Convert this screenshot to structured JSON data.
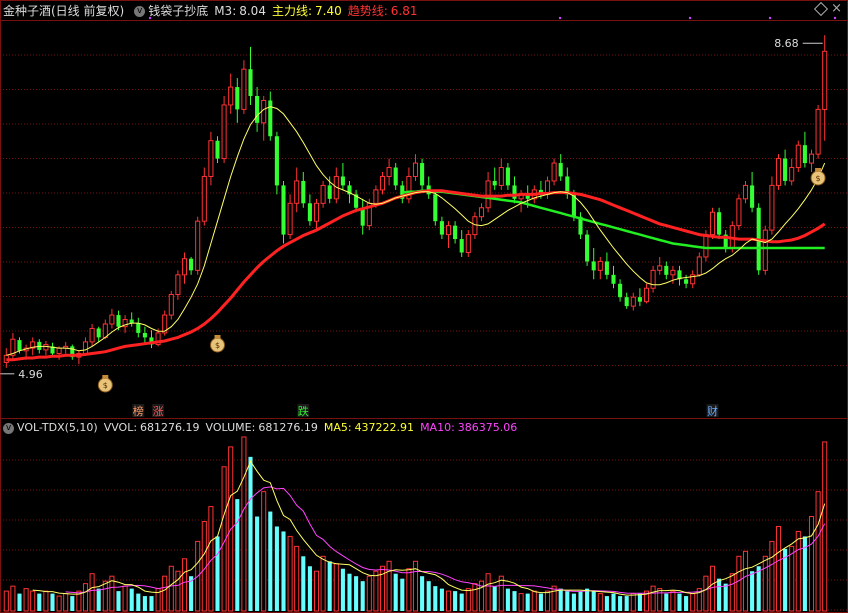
{
  "header": {
    "stock": "金种子酒(日线 前复权)",
    "indicator": "钱袋子抄底",
    "m3_label": "M3:",
    "m3_value": "8.04",
    "main_label": "主力线:",
    "main_value": "7.40",
    "trend_label": "趋势线:",
    "trend_value": "6.81"
  },
  "price_panel": {
    "high_label": "8.68",
    "low_label": "4.96",
    "ylim": [
      4.6,
      8.85
    ]
  },
  "markers": [
    {
      "text": "榜",
      "color": "#ff9966"
    },
    {
      "text": "涨",
      "color": "#ff5555"
    },
    {
      "text": "跌",
      "color": "#33ee33"
    },
    {
      "text": "财",
      "color": "#66aaff"
    }
  ],
  "volume_header": {
    "name": "VOL-TDX(5,10)",
    "vvol_label": "VVOL:",
    "vvol_value": "681276.19",
    "volume_label": "VOLUME:",
    "volume_value": "681276.19",
    "ma5_label": "MA5:",
    "ma5_value": "437222.91",
    "ma10_label": "MA10:",
    "ma10_value": "386375.06"
  },
  "colors": {
    "up": "#ff3333",
    "down": "#33ff33",
    "vol_down": "#66ffff",
    "m3": "#ffff66",
    "main": "#ff2222",
    "trend": "#22ee22",
    "ma5": "#ffff66",
    "ma10": "#ff44ff",
    "grid": "#7a1010"
  },
  "chart_data": {
    "type": "candlestick",
    "ylim": [
      4.6,
      8.85
    ],
    "candles": [
      [
        5.02,
        5.18,
        4.96,
        5.1
      ],
      [
        5.1,
        5.35,
        5.05,
        5.28
      ],
      [
        5.27,
        5.3,
        5.12,
        5.15
      ],
      [
        5.15,
        5.22,
        5.05,
        5.18
      ],
      [
        5.18,
        5.3,
        5.1,
        5.25
      ],
      [
        5.25,
        5.28,
        5.12,
        5.16
      ],
      [
        5.16,
        5.26,
        5.1,
        5.22
      ],
      [
        5.2,
        5.24,
        5.08,
        5.12
      ],
      [
        5.12,
        5.2,
        5.05,
        5.18
      ],
      [
        5.18,
        5.25,
        5.12,
        5.2
      ],
      [
        5.2,
        5.22,
        5.05,
        5.08
      ],
      [
        5.08,
        5.15,
        5.0,
        5.12
      ],
      [
        5.12,
        5.3,
        5.1,
        5.25
      ],
      [
        5.25,
        5.45,
        5.2,
        5.4
      ],
      [
        5.4,
        5.42,
        5.25,
        5.3
      ],
      [
        5.3,
        5.5,
        5.28,
        5.45
      ],
      [
        5.45,
        5.62,
        5.4,
        5.55
      ],
      [
        5.55,
        5.6,
        5.38,
        5.42
      ],
      [
        5.42,
        5.55,
        5.35,
        5.5
      ],
      [
        5.5,
        5.58,
        5.42,
        5.46
      ],
      [
        5.46,
        5.52,
        5.3,
        5.35
      ],
      [
        5.35,
        5.42,
        5.22,
        5.3
      ],
      [
        5.3,
        5.38,
        5.18,
        5.22
      ],
      [
        5.22,
        5.4,
        5.2,
        5.35
      ],
      [
        5.35,
        5.6,
        5.32,
        5.55
      ],
      [
        5.55,
        5.82,
        5.5,
        5.78
      ],
      [
        5.78,
        6.05,
        5.72,
        6.0
      ],
      [
        6.0,
        6.25,
        5.9,
        6.18
      ],
      [
        6.18,
        6.2,
        6.0,
        6.05
      ],
      [
        6.05,
        6.65,
        6.0,
        6.6
      ],
      [
        6.6,
        7.2,
        6.55,
        7.1
      ],
      [
        7.1,
        7.6,
        7.0,
        7.5
      ],
      [
        7.5,
        7.55,
        7.25,
        7.3
      ],
      [
        7.3,
        8.0,
        7.25,
        7.9
      ],
      [
        7.9,
        8.25,
        7.8,
        8.1
      ],
      [
        8.1,
        8.2,
        7.7,
        7.85
      ],
      [
        7.85,
        8.4,
        7.8,
        8.3
      ],
      [
        8.3,
        8.55,
        7.9,
        8.0
      ],
      [
        8.0,
        8.1,
        7.6,
        7.7
      ],
      [
        7.7,
        8.0,
        7.5,
        7.95
      ],
      [
        7.95,
        8.05,
        7.5,
        7.55
      ],
      [
        7.55,
        7.6,
        6.9,
        7.0
      ],
      [
        7.0,
        7.05,
        6.35,
        6.45
      ],
      [
        6.45,
        6.9,
        6.4,
        6.8
      ],
      [
        6.8,
        7.2,
        6.7,
        7.05
      ],
      [
        7.05,
        7.15,
        6.75,
        6.8
      ],
      [
        6.8,
        6.9,
        6.55,
        6.6
      ],
      [
        6.6,
        6.85,
        6.5,
        6.8
      ],
      [
        6.8,
        7.05,
        6.75,
        7.0
      ],
      [
        7.0,
        7.1,
        6.8,
        6.85
      ],
      [
        6.85,
        7.2,
        6.8,
        7.1
      ],
      [
        7.1,
        7.25,
        6.95,
        7.0
      ],
      [
        7.0,
        7.05,
        6.8,
        6.9
      ],
      [
        6.9,
        6.95,
        6.7,
        6.75
      ],
      [
        6.75,
        6.85,
        6.45,
        6.55
      ],
      [
        6.55,
        6.85,
        6.5,
        6.8
      ],
      [
        6.8,
        7.0,
        6.75,
        6.95
      ],
      [
        6.95,
        7.15,
        6.9,
        7.1
      ],
      [
        7.1,
        7.3,
        7.0,
        7.2
      ],
      [
        7.2,
        7.25,
        6.95,
        7.0
      ],
      [
        7.0,
        7.05,
        6.8,
        6.85
      ],
      [
        6.85,
        7.2,
        6.8,
        7.1
      ],
      [
        7.1,
        7.35,
        7.05,
        7.25
      ],
      [
        7.25,
        7.3,
        6.95,
        7.0
      ],
      [
        7.0,
        7.1,
        6.85,
        6.9
      ],
      [
        6.9,
        6.95,
        6.55,
        6.6
      ],
      [
        6.6,
        6.65,
        6.4,
        6.45
      ],
      [
        6.45,
        6.6,
        6.3,
        6.55
      ],
      [
        6.55,
        6.6,
        6.35,
        6.4
      ],
      [
        6.4,
        6.5,
        6.2,
        6.25
      ],
      [
        6.25,
        6.5,
        6.2,
        6.45
      ],
      [
        6.45,
        6.7,
        6.4,
        6.65
      ],
      [
        6.65,
        6.8,
        6.6,
        6.75
      ],
      [
        6.75,
        7.15,
        6.7,
        7.05
      ],
      [
        7.05,
        7.2,
        6.95,
        7.0
      ],
      [
        7.0,
        7.3,
        6.95,
        7.2
      ],
      [
        7.2,
        7.25,
        6.95,
        7.0
      ],
      [
        7.0,
        7.1,
        6.8,
        6.85
      ],
      [
        6.85,
        6.95,
        6.7,
        6.9
      ],
      [
        6.9,
        7.0,
        6.75,
        6.85
      ],
      [
        6.85,
        7.0,
        6.8,
        6.95
      ],
      [
        6.95,
        7.05,
        6.85,
        6.9
      ],
      [
        6.9,
        7.1,
        6.85,
        7.05
      ],
      [
        7.05,
        7.3,
        7.0,
        7.25
      ],
      [
        7.25,
        7.35,
        7.05,
        7.1
      ],
      [
        7.1,
        7.2,
        6.85,
        6.9
      ],
      [
        6.9,
        6.95,
        6.6,
        6.65
      ],
      [
        6.65,
        6.7,
        6.4,
        6.45
      ],
      [
        6.45,
        6.5,
        6.1,
        6.15
      ],
      [
        6.15,
        6.3,
        5.95,
        6.05
      ],
      [
        6.05,
        6.2,
        5.95,
        6.15
      ],
      [
        6.15,
        6.25,
        5.95,
        6.0
      ],
      [
        6.0,
        6.1,
        5.85,
        5.9
      ],
      [
        5.9,
        5.95,
        5.7,
        5.75
      ],
      [
        5.75,
        5.8,
        5.62,
        5.65
      ],
      [
        5.65,
        5.8,
        5.6,
        5.75
      ],
      [
        5.75,
        5.85,
        5.65,
        5.7
      ],
      [
        5.7,
        5.9,
        5.68,
        5.85
      ],
      [
        5.85,
        6.1,
        5.8,
        6.05
      ],
      [
        6.05,
        6.2,
        6.0,
        6.1
      ],
      [
        6.1,
        6.15,
        5.95,
        6.0
      ],
      [
        6.0,
        6.1,
        5.9,
        6.05
      ],
      [
        6.05,
        6.1,
        5.88,
        5.95
      ],
      [
        5.95,
        6.0,
        5.85,
        5.9
      ],
      [
        5.9,
        6.05,
        5.85,
        6.0
      ],
      [
        6.0,
        6.25,
        5.98,
        6.2
      ],
      [
        6.2,
        6.5,
        6.15,
        6.45
      ],
      [
        6.45,
        6.75,
        6.4,
        6.7
      ],
      [
        6.7,
        6.75,
        6.4,
        6.45
      ],
      [
        6.45,
        6.5,
        6.25,
        6.3
      ],
      [
        6.3,
        6.6,
        6.25,
        6.55
      ],
      [
        6.55,
        6.9,
        6.5,
        6.85
      ],
      [
        6.85,
        7.05,
        6.8,
        7.0
      ],
      [
        7.0,
        7.15,
        6.7,
        6.75
      ],
      [
        6.75,
        6.8,
        6.0,
        6.05
      ],
      [
        6.05,
        6.55,
        6.0,
        6.5
      ],
      [
        6.5,
        7.1,
        6.45,
        7.0
      ],
      [
        7.0,
        7.35,
        6.95,
        7.3
      ],
      [
        7.3,
        7.4,
        7.0,
        7.05
      ],
      [
        7.05,
        7.3,
        7.0,
        7.2
      ],
      [
        7.2,
        7.5,
        7.15,
        7.45
      ],
      [
        7.45,
        7.6,
        7.2,
        7.25
      ],
      [
        7.25,
        7.4,
        7.15,
        7.35
      ],
      [
        7.35,
        7.9,
        7.3,
        7.85
      ],
      [
        7.85,
        8.68,
        7.5,
        8.5
      ]
    ],
    "m3": [
      5.1,
      5.12,
      5.15,
      5.17,
      5.19,
      5.2,
      5.2,
      5.19,
      5.18,
      5.18,
      5.17,
      5.15,
      5.16,
      5.2,
      5.25,
      5.3,
      5.36,
      5.41,
      5.44,
      5.46,
      5.46,
      5.44,
      5.4,
      5.37,
      5.37,
      5.42,
      5.5,
      5.62,
      5.75,
      5.9,
      6.1,
      6.35,
      6.6,
      6.85,
      7.1,
      7.32,
      7.52,
      7.68,
      7.78,
      7.85,
      7.88,
      7.86,
      7.8,
      7.7,
      7.6,
      7.48,
      7.35,
      7.22,
      7.12,
      7.04,
      6.98,
      6.95,
      6.92,
      6.88,
      6.84,
      6.8,
      6.79,
      6.8,
      6.83,
      6.86,
      6.88,
      6.9,
      6.92,
      6.93,
      6.93,
      6.91,
      6.86,
      6.8,
      6.74,
      6.67,
      6.6,
      6.56,
      6.55,
      6.57,
      6.62,
      6.67,
      6.72,
      6.76,
      6.8,
      6.83,
      6.86,
      6.88,
      6.9,
      6.92,
      6.93,
      6.92,
      6.88,
      6.81,
      6.72,
      6.61,
      6.5,
      6.4,
      6.3,
      6.21,
      6.12,
      6.04,
      5.97,
      5.91,
      5.89,
      5.89,
      5.91,
      5.94,
      5.96,
      5.97,
      5.98,
      5.99,
      6.02,
      6.07,
      6.13,
      6.18,
      6.22,
      6.28,
      6.35,
      6.4,
      6.38,
      6.36,
      6.4,
      6.48,
      6.57,
      6.65,
      6.74,
      6.84,
      6.95,
      7.08,
      7.25
    ],
    "main": [
      5.05,
      5.05,
      5.06,
      5.07,
      5.07,
      5.08,
      5.08,
      5.09,
      5.09,
      5.1,
      5.1,
      5.1,
      5.11,
      5.12,
      5.13,
      5.14,
      5.16,
      5.18,
      5.2,
      5.21,
      5.22,
      5.23,
      5.24,
      5.25,
      5.26,
      5.28,
      5.3,
      5.33,
      5.36,
      5.4,
      5.45,
      5.51,
      5.58,
      5.66,
      5.74,
      5.83,
      5.92,
      6.0,
      6.08,
      6.15,
      6.21,
      6.27,
      6.32,
      6.36,
      6.4,
      6.44,
      6.47,
      6.5,
      6.54,
      6.58,
      6.62,
      6.66,
      6.69,
      6.72,
      6.74,
      6.76,
      6.78,
      6.8,
      6.83,
      6.86,
      6.88,
      6.9,
      6.92,
      6.93,
      6.94,
      6.94,
      6.94,
      6.93,
      6.92,
      6.91,
      6.9,
      6.89,
      6.88,
      6.88,
      6.88,
      6.88,
      6.89,
      6.89,
      6.9,
      6.9,
      6.9,
      6.91,
      6.91,
      6.92,
      6.92,
      6.92,
      6.91,
      6.9,
      6.88,
      6.86,
      6.84,
      6.81,
      6.78,
      6.75,
      6.72,
      6.69,
      6.66,
      6.63,
      6.6,
      6.57,
      6.55,
      6.53,
      6.51,
      6.49,
      6.47,
      6.45,
      6.44,
      6.43,
      6.42,
      6.42,
      6.41,
      6.4,
      6.4,
      6.4,
      6.39,
      6.38,
      6.37,
      6.37,
      6.38,
      6.39,
      6.41,
      6.44,
      6.48,
      6.52,
      6.57
    ],
    "trend": [
      null,
      null,
      null,
      null,
      null,
      null,
      null,
      null,
      null,
      null,
      null,
      null,
      null,
      null,
      null,
      null,
      null,
      null,
      null,
      null,
      null,
      null,
      null,
      null,
      null,
      null,
      null,
      null,
      null,
      null,
      null,
      null,
      null,
      null,
      null,
      null,
      null,
      null,
      null,
      null,
      null,
      null,
      null,
      null,
      null,
      null,
      null,
      null,
      null,
      null,
      null,
      null,
      null,
      null,
      null,
      null,
      null,
      null,
      null,
      null,
      6.92,
      6.93,
      6.93,
      6.94,
      6.94,
      6.93,
      6.93,
      6.92,
      6.91,
      6.9,
      6.89,
      6.88,
      6.87,
      6.86,
      6.85,
      6.84,
      6.83,
      6.82,
      6.81,
      6.79,
      6.77,
      6.75,
      6.73,
      6.71,
      6.69,
      6.67,
      6.65,
      6.63,
      6.61,
      6.59,
      6.57,
      6.55,
      6.53,
      6.51,
      6.49,
      6.47,
      6.45,
      6.43,
      6.41,
      6.39,
      6.37,
      6.35,
      6.34,
      6.33,
      6.32,
      6.31,
      6.3,
      6.3,
      6.3,
      6.3,
      6.3,
      6.3,
      6.3,
      6.3,
      6.3,
      6.3,
      6.3,
      6.3,
      6.3,
      6.3,
      6.3,
      6.3,
      6.3,
      6.3,
      6.3
    ],
    "volume": [
      8,
      10,
      7,
      9,
      8,
      7,
      8,
      7,
      6,
      7,
      6,
      8,
      11,
      15,
      9,
      12,
      14,
      8,
      10,
      9,
      7,
      6,
      6,
      9,
      14,
      18,
      16,
      21,
      14,
      28,
      36,
      42,
      30,
      58,
      66,
      45,
      70,
      62,
      38,
      48,
      40,
      34,
      32,
      30,
      26,
      22,
      18,
      16,
      22,
      20,
      19,
      17,
      15,
      14,
      12,
      14,
      16,
      18,
      20,
      15,
      13,
      17,
      20,
      14,
      12,
      10,
      9,
      8,
      8,
      7,
      9,
      11,
      12,
      15,
      10,
      14,
      9,
      8,
      7,
      7,
      8,
      7,
      8,
      10,
      9,
      8,
      7,
      8,
      9,
      8,
      7,
      6,
      7,
      6,
      6,
      7,
      7,
      8,
      10,
      9,
      7,
      8,
      7,
      6,
      7,
      9,
      14,
      18,
      13,
      11,
      15,
      22,
      24,
      16,
      18,
      22,
      28,
      34,
      25,
      26,
      32,
      30,
      38,
      48,
      68
    ],
    "vol_ylim": [
      0,
      72
    ],
    "markers_idx": [
      20,
      23,
      45,
      107
    ],
    "bag_idx": [
      15,
      32,
      123
    ]
  }
}
